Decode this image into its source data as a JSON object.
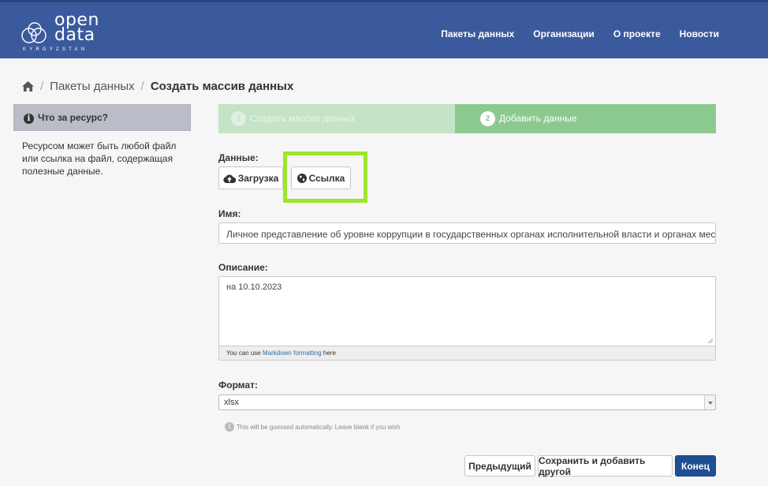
{
  "header": {
    "logo_word1": "open",
    "logo_word2": "data",
    "logo_sub": "KYRGYZSTAN",
    "nav": [
      "Пакеты данных",
      "Организации",
      "О проекте",
      "Новости"
    ],
    "bg_color": "#3b5a9d"
  },
  "breadcrumb": {
    "home_icon": "home-icon",
    "items": [
      "Пакеты данных",
      "Создать массив данных"
    ]
  },
  "sidebar": {
    "title": "Что за ресурс?",
    "text": "Ресурсом может быть любой файл или ссылка на файл, содержащая полезные данные."
  },
  "stages": [
    {
      "num": "1",
      "label": "Создать массив данных",
      "state": "complete"
    },
    {
      "num": "2",
      "label": "Добавить данные",
      "state": "active"
    }
  ],
  "form": {
    "data_label": "Данные:",
    "upload_label": "Загрузка",
    "link_label": "Ссылка",
    "name_label": "Имя:",
    "name_value": "Личное представление об уровне коррупции в государственных органах исполнительной власти и органах местного са",
    "description_label": "Описание:",
    "description_value": "на 10.10.2023",
    "md_prefix": "You can use ",
    "md_link": "Markdown formatting",
    "md_suffix": " here",
    "format_label": "Формат:",
    "format_value": "xlsx",
    "format_hint": "This will be guessed automatically. Leave blank if you wish"
  },
  "actions": {
    "previous": "Предыдущий",
    "save_add": "Сохранить и добавить другой",
    "finish": "Конец"
  },
  "colors": {
    "highlight": "#9ee62b",
    "stage_complete": "#c5e3c7",
    "stage_active": "#8cc98f",
    "primary": "#1f4f93"
  }
}
